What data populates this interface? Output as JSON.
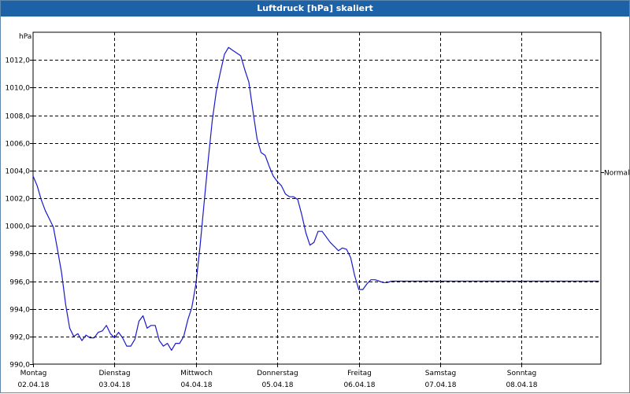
{
  "window": {
    "title": "Luftdruck [hPa] skaliert"
  },
  "chart_data": {
    "type": "line",
    "title": "Luftdruck [hPa] skaliert",
    "ylabel": "hPa",
    "ylim": [
      990.0,
      1014.0
    ],
    "xlim": [
      0,
      7
    ],
    "y_ticks": [
      990.0,
      992.0,
      994.0,
      996.0,
      998.0,
      1000.0,
      1002.0,
      1004.0,
      1006.0,
      1008.0,
      1010.0,
      1012.0
    ],
    "y_tick_labels": [
      "990,0",
      "992,0",
      "994,0",
      "996,0",
      "998,0",
      "1000,0",
      "1002,0",
      "1004,0",
      "1006,0",
      "1008,0",
      "1010,0",
      "1012,0"
    ],
    "x_ticks": [
      {
        "day": "Montag",
        "date": "02.04.18"
      },
      {
        "day": "Dienstag",
        "date": "03.04.18"
      },
      {
        "day": "Mittwoch",
        "date": "04.04.18"
      },
      {
        "day": "Donnerstag",
        "date": "05.04.18"
      },
      {
        "day": "Freitag",
        "date": "06.04.18"
      },
      {
        "day": "Samstag",
        "date": "07.04.18"
      },
      {
        "day": "Sonntag",
        "date": "08.04.18"
      }
    ],
    "grid": true,
    "reference_line": {
      "label": "Normal",
      "value": 1003.9
    },
    "line_color": "#1a1acc",
    "series": [
      {
        "x": [
          0.0,
          0.05,
          0.1,
          0.15,
          0.2,
          0.25,
          0.3,
          0.35,
          0.4,
          0.45,
          0.5,
          0.55,
          0.6,
          0.65,
          0.7,
          0.75,
          0.8,
          0.85,
          0.9,
          0.95,
          1.0,
          1.05,
          1.1,
          1.15,
          1.2,
          1.25,
          1.3,
          1.35,
          1.4,
          1.45,
          1.5,
          1.55,
          1.6,
          1.65,
          1.7,
          1.75,
          1.8,
          1.85,
          1.9,
          1.95,
          2.0,
          2.05,
          2.1,
          2.15,
          2.2,
          2.25,
          2.3,
          2.35,
          2.4,
          2.45,
          2.5,
          2.55,
          2.6,
          2.65,
          2.7,
          2.75,
          2.8,
          2.85,
          2.9,
          2.95,
          3.0,
          3.05,
          3.1,
          3.15,
          3.2,
          3.25,
          3.3,
          3.35,
          3.4,
          3.45,
          3.5,
          3.55,
          3.6,
          3.65,
          3.7,
          3.75,
          3.8,
          3.85,
          3.9,
          3.95,
          4.0,
          4.05,
          4.1,
          4.15,
          4.2,
          4.25,
          4.3,
          4.35,
          4.4,
          4.45,
          4.5,
          4.55,
          4.6,
          4.65,
          4.7,
          4.75,
          4.8,
          4.85,
          4.9,
          4.95,
          5.0,
          5.05,
          5.1,
          5.15,
          5.2,
          5.25,
          5.3,
          5.35,
          5.4,
          5.45,
          5.5,
          5.55,
          5.6,
          5.65,
          5.7,
          5.75,
          5.8,
          5.85,
          5.9,
          5.95,
          6.0,
          6.05,
          6.1,
          6.15,
          6.2,
          6.25,
          6.3,
          6.35,
          6.4,
          6.45,
          6.5,
          6.55,
          6.6,
          6.65,
          6.7,
          6.75,
          6.8,
          6.85,
          6.9,
          6.95,
          7.0
        ],
        "y": [
          1003.6,
          1002.9,
          1001.9,
          1001.1,
          1000.5,
          999.9,
          998.3,
          996.6,
          994.3,
          992.6,
          992.0,
          992.2,
          991.7,
          992.1,
          991.9,
          991.9,
          992.3,
          992.4,
          992.8,
          992.2,
          991.9,
          992.3,
          991.9,
          991.3,
          991.3,
          991.8,
          993.1,
          993.5,
          992.6,
          992.8,
          992.8,
          991.7,
          991.3,
          991.5,
          991.0,
          991.5,
          991.5,
          992.0,
          993.2,
          994.1,
          995.8,
          998.5,
          1001.6,
          1004.7,
          1007.6,
          1009.7,
          1011.1,
          1012.4,
          1012.9,
          1012.7,
          1012.5,
          1012.3,
          1011.3,
          1010.4,
          1008.3,
          1006.3,
          1005.3,
          1005.1,
          1004.3,
          1003.6,
          1003.2,
          1002.9,
          1002.3,
          1002.1,
          1002.1,
          1001.9,
          1000.8,
          999.5,
          998.6,
          998.8,
          999.6,
          999.6,
          999.2,
          998.8,
          998.5,
          998.2,
          998.4,
          998.3,
          997.7,
          996.4,
          995.4,
          995.4,
          995.8,
          996.1,
          996.1,
          996.0,
          995.9,
          995.9,
          996.0,
          996.0,
          996.0,
          996.0,
          996.0,
          996.0,
          996.0,
          996.0,
          996.0,
          996.0,
          996.0,
          996.0,
          996.0,
          996.0,
          996.0,
          996.0,
          996.0,
          996.0,
          996.0,
          996.0,
          996.0,
          996.0,
          996.0,
          996.0,
          996.0,
          996.0,
          996.0,
          996.0,
          996.0,
          996.0,
          996.0,
          996.0,
          996.0,
          996.0,
          996.0,
          996.0,
          996.0,
          996.0,
          996.0,
          996.0,
          996.0,
          996.0,
          996.0,
          996.0,
          996.0,
          996.0,
          996.0,
          996.0,
          996.0,
          996.0,
          996.0,
          996.0,
          996.0
        ]
      }
    ]
  }
}
